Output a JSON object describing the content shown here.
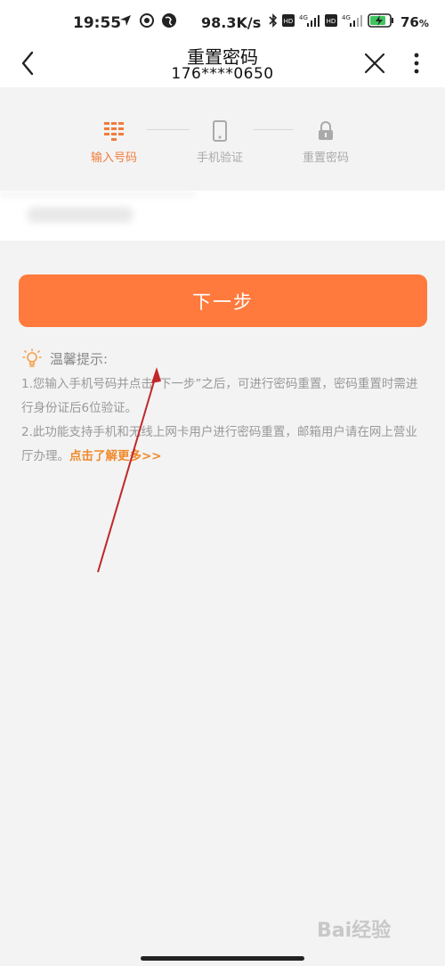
{
  "status_bar": {
    "time": "19:55",
    "network_speed": "98.3K/s",
    "battery": "76",
    "battery_unit": "%",
    "icons": [
      "navigation-icon",
      "sync-icon",
      "globe-icon",
      "bluetooth-icon",
      "hd-icon",
      "signal-4g-icon",
      "hd-icon",
      "signal-4g-icon",
      "battery-charging-icon"
    ]
  },
  "header": {
    "title": "重置密码",
    "subtitle": "176****0650"
  },
  "steps": [
    {
      "label": "输入号码",
      "icon": "keypad-icon",
      "active": true
    },
    {
      "label": "手机验证",
      "icon": "phone-icon",
      "active": false
    },
    {
      "label": "重置密码",
      "icon": "lock-icon",
      "active": false
    }
  ],
  "next_button": {
    "label": "下一步"
  },
  "tips": {
    "title": "温馨提示:",
    "line1": "1.您输入手机号码并点击“下一步”之后，可进行密码重置，密码重置时需进行身份证后6位验证。",
    "line2": "2.此功能支持手机和无线上网卡用户进行密码重置，邮箱用户请在网上营业厅办理。",
    "more_link": "点击了解更多>>"
  },
  "watermark": "Bai经验",
  "colors": {
    "accent": "#ff7a3c",
    "link": "#f08a2c",
    "arrow": "#c0282a"
  }
}
